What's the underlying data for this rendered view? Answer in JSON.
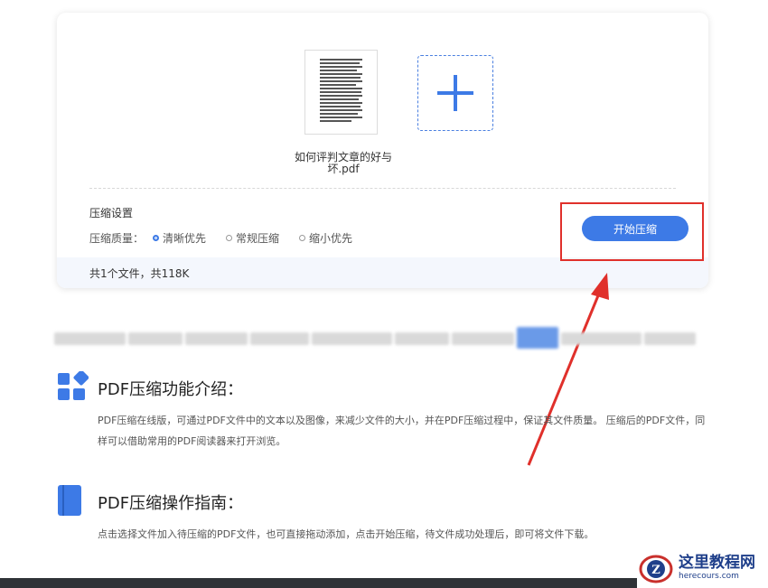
{
  "upload": {
    "file_name": "如何评判文章的好与坏.pdf",
    "add_icon": "plus-icon"
  },
  "settings": {
    "title": "压缩设置",
    "quality_label": "压缩质量：",
    "options": [
      {
        "label": "清晰优先",
        "selected": true
      },
      {
        "label": "常规压缩",
        "selected": false
      },
      {
        "label": "缩小优先",
        "selected": false
      }
    ],
    "start_button": "开始压缩"
  },
  "footer": {
    "summary": "共1个文件，共118K"
  },
  "sections": [
    {
      "title": "PDF压缩功能介绍：",
      "icon": "apps-grid-icon",
      "text": "PDF压缩在线版，可通过PDF文件中的文本以及图像，来减少文件的大小，并在PDF压缩过程中，保证其文件质量。 压缩后的PDF文件，同样可以借助常用的PDF阅读器来打开浏览。"
    },
    {
      "title": "PDF压缩操作指南：",
      "icon": "book-icon",
      "text": "点击选择文件加入待压缩的PDF文件，也可直接拖动添加，点击开始压缩，待文件成功处理后，即可将文件下载。"
    }
  ],
  "watermark": {
    "cn": "这里教程网",
    "en": "herecours.com"
  },
  "colors": {
    "accent": "#3d7ae6",
    "highlight": "#e0302b",
    "footer_bg": "#f4f7fd"
  }
}
